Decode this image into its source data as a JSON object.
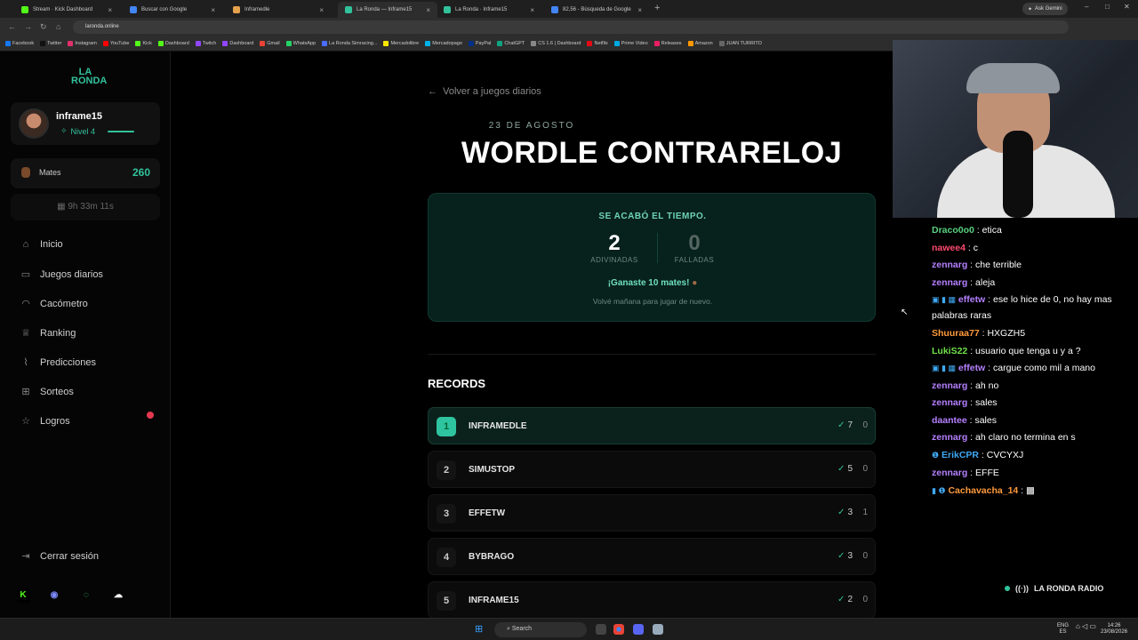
{
  "browser": {
    "tabs": [
      {
        "label": "Stream · Kick Dashboard",
        "color": "#53fc18",
        "active": false
      },
      {
        "label": "Buscar con Google",
        "color": "#4285f4",
        "active": false
      },
      {
        "label": "Inframedle",
        "color": "#e5a24c",
        "active": false
      },
      {
        "label": "La Ronda — Inframe15",
        "color": "#31c29b",
        "active": true
      },
      {
        "label": "La Ronda · Inframe15",
        "color": "#31c29b",
        "active": false
      },
      {
        "label": "82,56 - Búsqueda de Google",
        "color": "#4285f4",
        "active": false
      }
    ],
    "ask_gemini": "Ask Gemini",
    "url": "laronda.online",
    "bookmarks": [
      {
        "label": "Facebook",
        "color": "#1877f2"
      },
      {
        "label": "Twitter",
        "color": "#111"
      },
      {
        "label": "Instagram",
        "color": "#e1306c"
      },
      {
        "label": "YouTube",
        "color": "#ff0000"
      },
      {
        "label": "Kick",
        "color": "#53fc18"
      },
      {
        "label": "Dashboard",
        "color": "#53fc18"
      },
      {
        "label": "Twitch",
        "color": "#9146ff"
      },
      {
        "label": "Dashboard",
        "color": "#9146ff"
      },
      {
        "label": "Gmail",
        "color": "#ea4335"
      },
      {
        "label": "WhatsApp",
        "color": "#25d366"
      },
      {
        "label": "La Ronda Simracing...",
        "color": "#4a6cff"
      },
      {
        "label": "Mercadolibre",
        "color": "#ffe600"
      },
      {
        "label": "Mercadopago",
        "color": "#00b1ea"
      },
      {
        "label": "PayPal",
        "color": "#003087"
      },
      {
        "label": "ChatGPT",
        "color": "#10a37f"
      },
      {
        "label": "CS 1.6 | Dashboard",
        "color": "#888"
      },
      {
        "label": "Netflix",
        "color": "#e50914"
      },
      {
        "label": "Prime Video",
        "color": "#00a8e1"
      },
      {
        "label": "Releases",
        "color": "#e91e63"
      },
      {
        "label": "Amazon",
        "color": "#ff9900"
      },
      {
        "label": "JUAN TURRITO",
        "color": "#666"
      }
    ]
  },
  "sidebar": {
    "logo": "LA RONDA",
    "user": {
      "name": "inframe15",
      "level": "Nivel 4",
      "level_progress": 0.6
    },
    "mates": {
      "label": "Mates",
      "value": "260"
    },
    "timer": "9h 33m 11s",
    "nav": [
      {
        "label": "Inicio",
        "icon": "home-icon",
        "glyph": "⌂"
      },
      {
        "label": "Juegos diarios",
        "icon": "gamepad-icon",
        "glyph": "▭"
      },
      {
        "label": "Cacómetro",
        "icon": "gauge-icon",
        "glyph": "◠"
      },
      {
        "label": "Ranking",
        "icon": "trophy-icon",
        "glyph": "♕"
      },
      {
        "label": "Predicciones",
        "icon": "chart-icon",
        "glyph": "⌇"
      },
      {
        "label": "Sorteos",
        "icon": "gift-icon",
        "glyph": "⊞"
      },
      {
        "label": "Logros",
        "icon": "medal-icon",
        "glyph": "☆"
      }
    ],
    "logout": "Cerrar sesión"
  },
  "main": {
    "back": "Volver a juegos diarios",
    "date": "23 DE AGOSTO",
    "title": "WORDLE CONTRARELOJ",
    "result": {
      "status": "SE ACABÓ EL TIEMPO.",
      "guessed_value": "2",
      "guessed_label": "ADIVINADAS",
      "failed_value": "0",
      "failed_label": "FALLADAS",
      "won": "¡Ganaste 10 mates!",
      "again": "Volvé mañana para jugar de nuevo."
    },
    "records_title": "RECORDS",
    "records": [
      {
        "rank": "1",
        "name": "INFRAMEDLE",
        "wins": "7",
        "fails": "0"
      },
      {
        "rank": "2",
        "name": "SIMUSTOP",
        "wins": "5",
        "fails": "0"
      },
      {
        "rank": "3",
        "name": "EFFETW",
        "wins": "3",
        "fails": "1"
      },
      {
        "rank": "4",
        "name": "BYBRAGO",
        "wins": "3",
        "fails": "0"
      },
      {
        "rank": "5",
        "name": "INFRAME15",
        "wins": "2",
        "fails": "0"
      }
    ]
  },
  "chat": [
    {
      "user": "Draco0o0",
      "color": "#5ad17e",
      "text": "etica",
      "badges": ""
    },
    {
      "user": "nawee4",
      "color": "#ff4a6e",
      "text": "c",
      "badges": ""
    },
    {
      "user": "zennarg",
      "color": "#b580ff",
      "text": "che terrible",
      "badges": ""
    },
    {
      "user": "zennarg",
      "color": "#b580ff",
      "text": "aleja",
      "badges": ""
    },
    {
      "user": "effetw",
      "color": "#b580ff",
      "text": "ese lo hice de 0, no hay mas palabras raras",
      "badges": "▣ ▮ ▦"
    },
    {
      "user": "Shuuraa77",
      "color": "#ff9a3c",
      "text": "HXGZH5",
      "badges": ""
    },
    {
      "user": "LukiS22",
      "color": "#6fe04a",
      "text": "usuario que tenga u y a ?",
      "badges": ""
    },
    {
      "user": "effetw",
      "color": "#b580ff",
      "text": "cargue como mil a mano",
      "badges": "▣ ▮ ▦"
    },
    {
      "user": "zennarg",
      "color": "#b580ff",
      "text": "ah no",
      "badges": ""
    },
    {
      "user": "zennarg",
      "color": "#b580ff",
      "text": "sales",
      "badges": ""
    },
    {
      "user": "daantee",
      "color": "#b580ff",
      "text": "sales",
      "badges": ""
    },
    {
      "user": "zennarg",
      "color": "#b580ff",
      "text": "ah claro no termina en s",
      "badges": ""
    },
    {
      "user": "ErikCPR",
      "color": "#3fa9f5",
      "text": "CVCYXJ",
      "badges": "❶"
    },
    {
      "user": "zennarg",
      "color": "#b580ff",
      "text": "EFFE",
      "badges": ""
    },
    {
      "user": "Cachavacha_14",
      "color": "#ff9a3c",
      "text": "▩",
      "badges": "▮ ❶"
    }
  ],
  "radio": "LA RONDA RADIO",
  "taskbar": {
    "search": "Search",
    "lang_top": "ENG",
    "lang_bottom": "ES",
    "time": "14:26",
    "date": "23/08/2026"
  }
}
